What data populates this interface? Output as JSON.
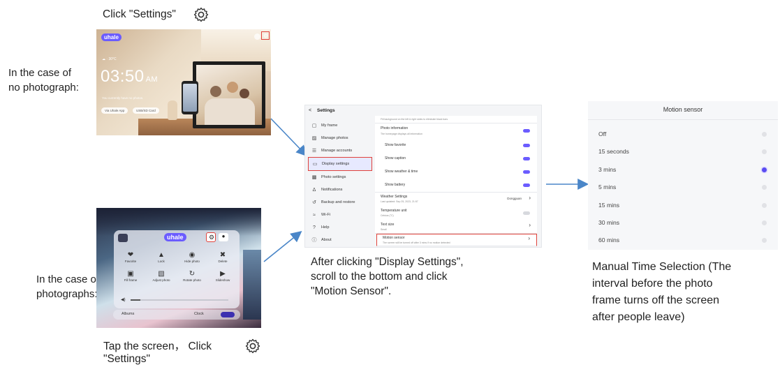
{
  "instructions": {
    "click_settings_top": "Click \"Settings\"",
    "case_no_photo_line1": "In the case of",
    "case_no_photo_line2": "no photograph:",
    "case_photos_line1": "In the case of",
    "case_photos_line2": "photographs:",
    "tap_screen_line1": "Tap the screen， Click",
    "tap_screen_line2": "\"Settings\"",
    "after_display_line1": "After clicking \"Display Settings\",",
    "after_display_line2": "scroll to the bottom and click",
    "after_display_line3": "\"Motion Sensor\".",
    "manual_line1": "Manual Time Selection (The",
    "manual_line2": "interval before the photo",
    "manual_line3": "frame turns off the screen",
    "manual_line4": "after people leave)"
  },
  "no_photo_screen": {
    "brand": "uhale",
    "clock_time": "03:50",
    "clock_ampm": "AM",
    "weather": "☁ · 30°C",
    "hint": "You currently have no photos.",
    "pill1": "Via Uhale App",
    "pill2": "USB/SD Card"
  },
  "photo_screen": {
    "brand": "uhale",
    "items": [
      {
        "icon": "❤",
        "label": "Favorite"
      },
      {
        "icon": "▲",
        "label": "Lock"
      },
      {
        "icon": "◉",
        "label": "Hide photo"
      },
      {
        "icon": "✖",
        "label": "Delete"
      },
      {
        "icon": "▣",
        "label": "Fill frame"
      },
      {
        "icon": "▧",
        "label": "Adjust photo"
      },
      {
        "icon": "↻",
        "label": "Rotate photo"
      },
      {
        "icon": "▶",
        "label": "Slideshow"
      }
    ],
    "albums_label": "Albums",
    "clock_label": "Clock"
  },
  "settings": {
    "back": "<",
    "title": "Settings",
    "sidebar": [
      {
        "icon": "▢",
        "label": "My frame"
      },
      {
        "icon": "▨",
        "label": "Manage photos"
      },
      {
        "icon": "☰",
        "label": "Manage accounts"
      },
      {
        "icon": "▭",
        "label": "Display settings"
      },
      {
        "icon": "▩",
        "label": "Photo settings"
      },
      {
        "icon": "Δ",
        "label": "Notifications"
      },
      {
        "icon": "↺",
        "label": "Backup and restore"
      },
      {
        "icon": "≈",
        "label": "Wi-Fi"
      },
      {
        "icon": "?",
        "label": "Help"
      },
      {
        "icon": "ⓘ",
        "label": "About"
      }
    ],
    "top_note": "Fill background on the left & right sides to eliminate black bars",
    "photo_info_title": "Photo information",
    "photo_info_sub": "The homepage displays all information",
    "toggles": [
      "Show favorite",
      "Show caption",
      "Show weather & time",
      "Show battery"
    ],
    "weather_title": "Weather Settings",
    "weather_sub": "Last updated: Sep 25, 2023, 21:57",
    "weather_value": "Dongguan",
    "temp_title": "Temperature unit",
    "temp_sub": "Celsius (°C)",
    "text_size_title": "Text size",
    "text_size_sub": "Small",
    "motion_title": "Motion sensor",
    "motion_sub": "The screen will be turned off after 3 mins if no motion detected"
  },
  "motion_sensor": {
    "title": "Motion sensor",
    "options": [
      "Off",
      "15 seconds",
      "3 mins",
      "5 mins",
      "15 mins",
      "30 mins",
      "60 mins"
    ],
    "selected": "3 mins"
  },
  "colors": {
    "accent": "#6b5cff",
    "highlight_box": "#e0413a",
    "arrow": "#4a86c8"
  }
}
